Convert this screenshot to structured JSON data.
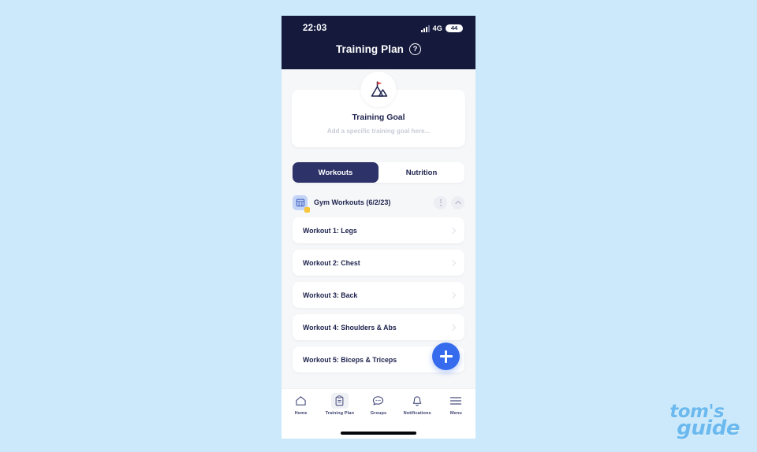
{
  "page": {
    "background_color": "#cbe9fb"
  },
  "status_bar": {
    "time": "22:03",
    "network": "4G",
    "battery": "44",
    "signal_icon": "signal-bars-icon",
    "battery_icon": "battery-icon"
  },
  "header": {
    "title": "Training Plan",
    "help_label": "?",
    "help_icon": "help-circle-icon",
    "background_color": "#151a3d"
  },
  "goal": {
    "icon": "mountain-flag-icon",
    "title": "Training Goal",
    "placeholder": "Add a specific training goal here..."
  },
  "tabs": [
    {
      "label": "Workouts",
      "active": true
    },
    {
      "label": "Nutrition",
      "active": false
    }
  ],
  "group": {
    "icon": "gym-calendar-icon",
    "badge_color": "#f9c53a",
    "title": "Gym Workouts (6/2/23)",
    "more_icon": "more-vertical-icon",
    "collapse_icon": "chevron-up-icon"
  },
  "workouts": [
    {
      "label": "Workout 1: Legs",
      "chevron": "chevron-right-icon"
    },
    {
      "label": "Workout 2: Chest",
      "chevron": "chevron-right-icon"
    },
    {
      "label": "Workout 3: Back",
      "chevron": "chevron-right-icon"
    },
    {
      "label": "Workout 4: Shoulders & Abs",
      "chevron": "chevron-right-icon"
    },
    {
      "label": "Workout 5: Biceps & Triceps",
      "chevron": "chevron-right-icon"
    }
  ],
  "fab": {
    "icon": "plus-icon",
    "color": "#356bec"
  },
  "bottom_nav": [
    {
      "label": "Home",
      "icon": "home-icon",
      "active": false
    },
    {
      "label": "Training Plan",
      "icon": "clipboard-icon",
      "active": true
    },
    {
      "label": "Groups",
      "icon": "chat-bubble-icon",
      "active": false
    },
    {
      "label": "Notifications",
      "icon": "bell-icon",
      "active": false
    },
    {
      "label": "Menu",
      "icon": "hamburger-menu-icon",
      "active": false
    }
  ],
  "watermark": {
    "line1": "tom's",
    "line2": "guide",
    "color": "#6bb9ee"
  }
}
